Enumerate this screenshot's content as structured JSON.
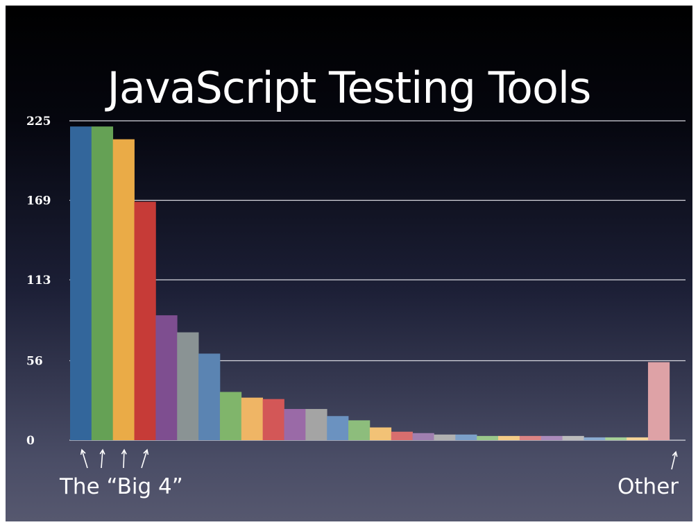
{
  "title": "JavaScript Testing Tools",
  "annotations": {
    "big4": "The “Big 4”",
    "other": "Other"
  },
  "chart_data": {
    "type": "bar",
    "title": "JavaScript Testing Tools",
    "xlabel": "",
    "ylabel": "",
    "ylim": [
      0,
      225
    ],
    "yticks": [
      0,
      56,
      113,
      169,
      225
    ],
    "grid": true,
    "values": [
      221,
      221,
      212,
      168,
      88,
      76,
      61,
      34,
      30,
      29,
      22,
      22,
      17,
      14,
      9,
      6,
      5,
      4,
      4,
      3,
      3,
      3,
      3,
      3,
      2,
      2,
      2,
      55
    ],
    "colors": [
      "#33669b",
      "#65a155",
      "#eaab47",
      "#c63b37",
      "#7e4e90",
      "#8a9394",
      "#5b84b2",
      "#80b56b",
      "#efb565",
      "#d35757",
      "#9a6aa7",
      "#a4a4a4",
      "#6b92c0",
      "#8dbd7c",
      "#f2c276",
      "#d86e6e",
      "#a07fb0",
      "#b1b1b1",
      "#7ca0c9",
      "#9ac78b",
      "#f4cc87",
      "#dc8484",
      "#ab8bbb",
      "#bcbcbc",
      "#8aabd0",
      "#a6d098",
      "#f5d498",
      "#dea2a6"
    ]
  }
}
